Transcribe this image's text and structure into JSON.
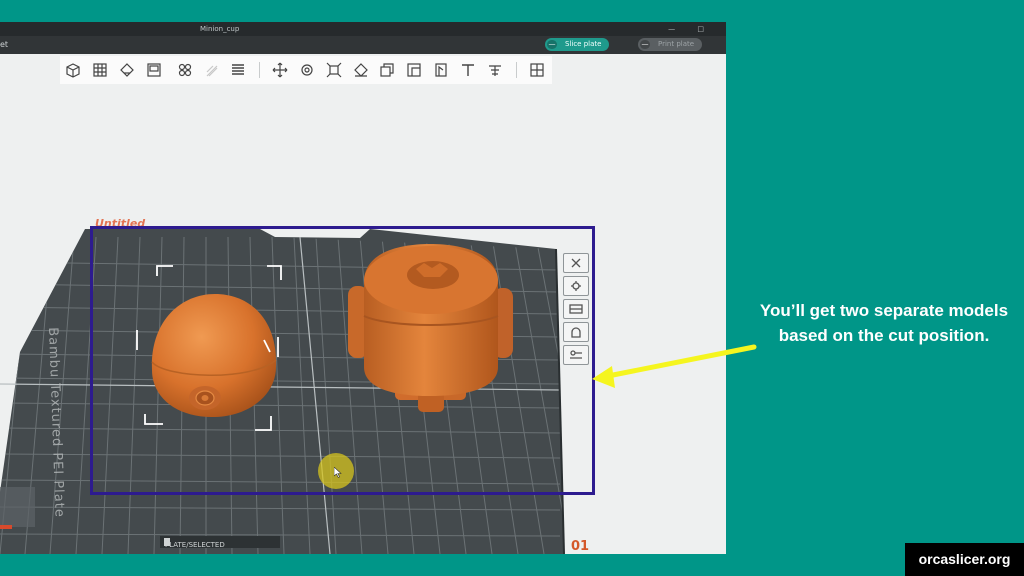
{
  "window": {
    "title": "Minion_cup"
  },
  "menubar": {
    "left_item": "et"
  },
  "topbar": {
    "slice_button": "Slice plate",
    "print_button": "Print plate",
    "dropdown_glyph": "—"
  },
  "toolbar": {
    "tools": [
      "add-cube-icon",
      "grid-arrange-icon",
      "orient-icon",
      "layout-icon",
      "assemble-icon",
      "ghost-tool-icon",
      "layers-icon",
      "move-icon",
      "rotate-icon",
      "scale-icon",
      "lay-flat-icon",
      "support-paint-icon",
      "seam-paint-icon",
      "cut-icon",
      "text-icon",
      "emboss-icon",
      "split-view-icon"
    ]
  },
  "plate": {
    "name": "Untitled",
    "brand_text": "Bambu Textured PEI Plate",
    "number": "01",
    "bed_label": "PLATE/SELECTED",
    "side_icons": [
      "close-icon",
      "settings-icon",
      "arrange-icon",
      "lock-icon",
      "config-icon"
    ]
  },
  "annotation": {
    "caption": "You’ll get two separate models based on the cut position."
  },
  "colors": {
    "background": "#009688",
    "model": "#d8722c",
    "highlight_box": "#2d1b8f",
    "arrow": "#f5f51f"
  },
  "watermark": "orcaslicer.org"
}
